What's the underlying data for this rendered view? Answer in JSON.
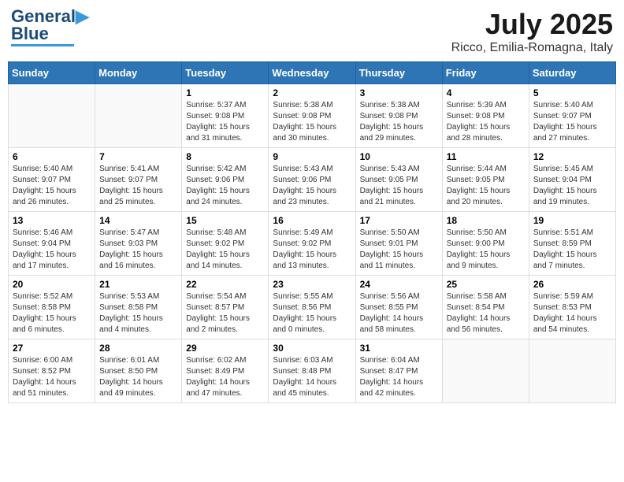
{
  "header": {
    "logo_line1": "General",
    "logo_line2": "Blue",
    "month_year": "July 2025",
    "location": "Ricco, Emilia-Romagna, Italy"
  },
  "days_of_week": [
    "Sunday",
    "Monday",
    "Tuesday",
    "Wednesday",
    "Thursday",
    "Friday",
    "Saturday"
  ],
  "weeks": [
    [
      {
        "day": "",
        "sunrise": "",
        "sunset": "",
        "daylight": ""
      },
      {
        "day": "",
        "sunrise": "",
        "sunset": "",
        "daylight": ""
      },
      {
        "day": "1",
        "sunrise": "Sunrise: 5:37 AM",
        "sunset": "Sunset: 9:08 PM",
        "daylight": "Daylight: 15 hours and 31 minutes."
      },
      {
        "day": "2",
        "sunrise": "Sunrise: 5:38 AM",
        "sunset": "Sunset: 9:08 PM",
        "daylight": "Daylight: 15 hours and 30 minutes."
      },
      {
        "day": "3",
        "sunrise": "Sunrise: 5:38 AM",
        "sunset": "Sunset: 9:08 PM",
        "daylight": "Daylight: 15 hours and 29 minutes."
      },
      {
        "day": "4",
        "sunrise": "Sunrise: 5:39 AM",
        "sunset": "Sunset: 9:08 PM",
        "daylight": "Daylight: 15 hours and 28 minutes."
      },
      {
        "day": "5",
        "sunrise": "Sunrise: 5:40 AM",
        "sunset": "Sunset: 9:07 PM",
        "daylight": "Daylight: 15 hours and 27 minutes."
      }
    ],
    [
      {
        "day": "6",
        "sunrise": "Sunrise: 5:40 AM",
        "sunset": "Sunset: 9:07 PM",
        "daylight": "Daylight: 15 hours and 26 minutes."
      },
      {
        "day": "7",
        "sunrise": "Sunrise: 5:41 AM",
        "sunset": "Sunset: 9:07 PM",
        "daylight": "Daylight: 15 hours and 25 minutes."
      },
      {
        "day": "8",
        "sunrise": "Sunrise: 5:42 AM",
        "sunset": "Sunset: 9:06 PM",
        "daylight": "Daylight: 15 hours and 24 minutes."
      },
      {
        "day": "9",
        "sunrise": "Sunrise: 5:43 AM",
        "sunset": "Sunset: 9:06 PM",
        "daylight": "Daylight: 15 hours and 23 minutes."
      },
      {
        "day": "10",
        "sunrise": "Sunrise: 5:43 AM",
        "sunset": "Sunset: 9:05 PM",
        "daylight": "Daylight: 15 hours and 21 minutes."
      },
      {
        "day": "11",
        "sunrise": "Sunrise: 5:44 AM",
        "sunset": "Sunset: 9:05 PM",
        "daylight": "Daylight: 15 hours and 20 minutes."
      },
      {
        "day": "12",
        "sunrise": "Sunrise: 5:45 AM",
        "sunset": "Sunset: 9:04 PM",
        "daylight": "Daylight: 15 hours and 19 minutes."
      }
    ],
    [
      {
        "day": "13",
        "sunrise": "Sunrise: 5:46 AM",
        "sunset": "Sunset: 9:04 PM",
        "daylight": "Daylight: 15 hours and 17 minutes."
      },
      {
        "day": "14",
        "sunrise": "Sunrise: 5:47 AM",
        "sunset": "Sunset: 9:03 PM",
        "daylight": "Daylight: 15 hours and 16 minutes."
      },
      {
        "day": "15",
        "sunrise": "Sunrise: 5:48 AM",
        "sunset": "Sunset: 9:02 PM",
        "daylight": "Daylight: 15 hours and 14 minutes."
      },
      {
        "day": "16",
        "sunrise": "Sunrise: 5:49 AM",
        "sunset": "Sunset: 9:02 PM",
        "daylight": "Daylight: 15 hours and 13 minutes."
      },
      {
        "day": "17",
        "sunrise": "Sunrise: 5:50 AM",
        "sunset": "Sunset: 9:01 PM",
        "daylight": "Daylight: 15 hours and 11 minutes."
      },
      {
        "day": "18",
        "sunrise": "Sunrise: 5:50 AM",
        "sunset": "Sunset: 9:00 PM",
        "daylight": "Daylight: 15 hours and 9 minutes."
      },
      {
        "day": "19",
        "sunrise": "Sunrise: 5:51 AM",
        "sunset": "Sunset: 8:59 PM",
        "daylight": "Daylight: 15 hours and 7 minutes."
      }
    ],
    [
      {
        "day": "20",
        "sunrise": "Sunrise: 5:52 AM",
        "sunset": "Sunset: 8:58 PM",
        "daylight": "Daylight: 15 hours and 6 minutes."
      },
      {
        "day": "21",
        "sunrise": "Sunrise: 5:53 AM",
        "sunset": "Sunset: 8:58 PM",
        "daylight": "Daylight: 15 hours and 4 minutes."
      },
      {
        "day": "22",
        "sunrise": "Sunrise: 5:54 AM",
        "sunset": "Sunset: 8:57 PM",
        "daylight": "Daylight: 15 hours and 2 minutes."
      },
      {
        "day": "23",
        "sunrise": "Sunrise: 5:55 AM",
        "sunset": "Sunset: 8:56 PM",
        "daylight": "Daylight: 15 hours and 0 minutes."
      },
      {
        "day": "24",
        "sunrise": "Sunrise: 5:56 AM",
        "sunset": "Sunset: 8:55 PM",
        "daylight": "Daylight: 14 hours and 58 minutes."
      },
      {
        "day": "25",
        "sunrise": "Sunrise: 5:58 AM",
        "sunset": "Sunset: 8:54 PM",
        "daylight": "Daylight: 14 hours and 56 minutes."
      },
      {
        "day": "26",
        "sunrise": "Sunrise: 5:59 AM",
        "sunset": "Sunset: 8:53 PM",
        "daylight": "Daylight: 14 hours and 54 minutes."
      }
    ],
    [
      {
        "day": "27",
        "sunrise": "Sunrise: 6:00 AM",
        "sunset": "Sunset: 8:52 PM",
        "daylight": "Daylight: 14 hours and 51 minutes."
      },
      {
        "day": "28",
        "sunrise": "Sunrise: 6:01 AM",
        "sunset": "Sunset: 8:50 PM",
        "daylight": "Daylight: 14 hours and 49 minutes."
      },
      {
        "day": "29",
        "sunrise": "Sunrise: 6:02 AM",
        "sunset": "Sunset: 8:49 PM",
        "daylight": "Daylight: 14 hours and 47 minutes."
      },
      {
        "day": "30",
        "sunrise": "Sunrise: 6:03 AM",
        "sunset": "Sunset: 8:48 PM",
        "daylight": "Daylight: 14 hours and 45 minutes."
      },
      {
        "day": "31",
        "sunrise": "Sunrise: 6:04 AM",
        "sunset": "Sunset: 8:47 PM",
        "daylight": "Daylight: 14 hours and 42 minutes."
      },
      {
        "day": "",
        "sunrise": "",
        "sunset": "",
        "daylight": ""
      },
      {
        "day": "",
        "sunrise": "",
        "sunset": "",
        "daylight": ""
      }
    ]
  ]
}
